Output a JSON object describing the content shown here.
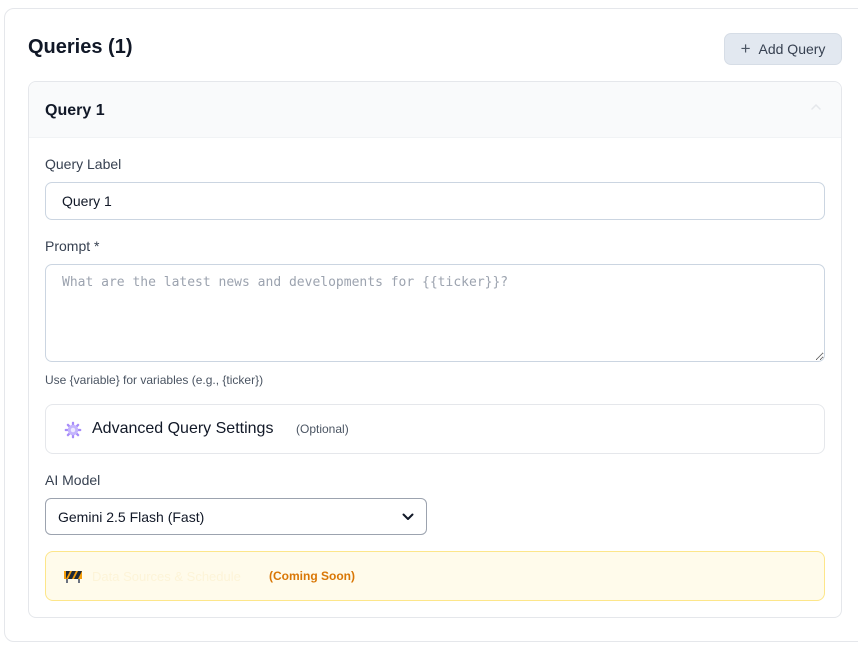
{
  "header": {
    "title": "Queries (1)",
    "add_button_label": "Add Query"
  },
  "query": {
    "title": "Query 1",
    "label_field_label": "Query Label",
    "label_value": "Query 1",
    "prompt_label": "Prompt *",
    "prompt_placeholder": "What are the latest news and developments for {{ticker}}?",
    "prompt_help": "Use {variable} for variables (e.g., {ticker})",
    "advanced": {
      "title": "Advanced Query Settings",
      "optional": "(Optional)"
    },
    "model_label": "AI Model",
    "model_value": "Gemini 2.5 Flash (Fast)",
    "coming_soon": {
      "faded_text": "Data Sources & Schedule",
      "badge": "(Coming Soon)"
    }
  },
  "icons": {
    "add": "plus-icon",
    "collapse": "chevron-up-icon",
    "advanced": "gear-icon",
    "select": "chevron-down-icon",
    "coming_soon": "construction-barrier-icon"
  },
  "colors": {
    "add_button_bg": "#e2e8f0",
    "coming_soon_text": "#d97706",
    "coming_soon_bg": "#fffbeb",
    "coming_soon_border": "#fde68a"
  }
}
